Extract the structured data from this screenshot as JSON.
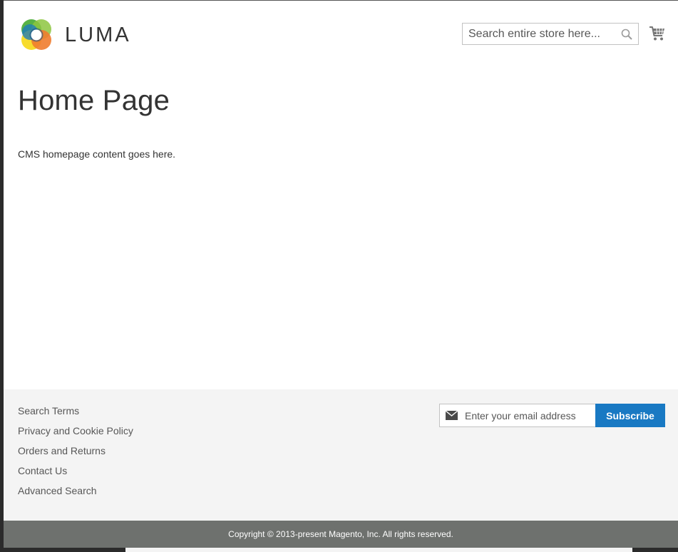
{
  "header": {
    "logo_text": "LUMA",
    "search": {
      "placeholder": "Search entire store here..."
    }
  },
  "main": {
    "title": "Home Page",
    "content": "CMS homepage content goes here."
  },
  "footer": {
    "links": [
      {
        "label": "Search Terms"
      },
      {
        "label": "Privacy and Cookie Policy"
      },
      {
        "label": "Orders and Returns"
      },
      {
        "label": "Contact Us"
      },
      {
        "label": "Advanced Search"
      }
    ],
    "newsletter": {
      "placeholder": "Enter your email address",
      "button_label": "Subscribe"
    },
    "copyright": "Copyright © 2013-present Magento, Inc. All rights reserved."
  },
  "icons": {
    "search": "search-icon",
    "cart": "cart-icon",
    "email": "envelope-icon",
    "logo": "luma-logo-icon"
  },
  "colors": {
    "accent": "#1979c3",
    "footer_bg": "#f4f4f4",
    "copyright_bg": "#6e716e",
    "text": "#333333"
  }
}
